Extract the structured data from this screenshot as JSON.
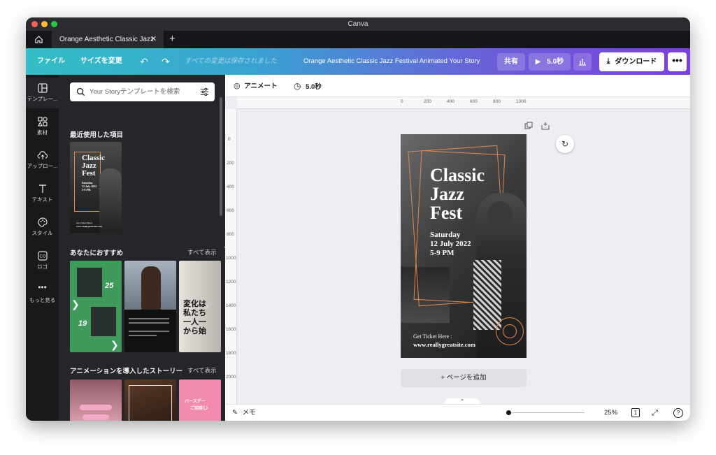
{
  "window": {
    "title": "Canva"
  },
  "tabs": {
    "active_label": "Orange Aesthetic Classic Jazz"
  },
  "toolbar": {
    "file_label": "ファイル",
    "resize_label": "サイズを変更",
    "saved_status": "すべての変更は保存されました",
    "document_title": "Orange Aesthetic Classic Jazz Festival Animated Your Story",
    "share_label": "共有",
    "play_label": "5.0秒",
    "download_label": "ダウンロード",
    "more_label": "•••"
  },
  "rail": {
    "items": [
      {
        "label": "テンプレー..."
      },
      {
        "label": "素材"
      },
      {
        "label": "アップロー..."
      },
      {
        "label": "テキスト"
      },
      {
        "label": "スタイル"
      },
      {
        "label": "ロゴ"
      },
      {
        "label": "もっと見る"
      }
    ]
  },
  "panel": {
    "search_placeholder": "Your Storyテンプレートを検索",
    "recent_title": "最近使用した項目",
    "recommended_title": "あなたにおすすめ",
    "recommended_see_all": "すべて表示",
    "animated_title": "アニメーションを導入したストーリー",
    "animated_see_all": "すべて表示",
    "recent_thumb": {
      "title_line1": "Classic",
      "title_line2": "Jazz",
      "title_line3": "Fest",
      "date_line1": "Saturday",
      "date_line2": "12 July 2022",
      "date_line3": "5-9 PM",
      "ticket": "Get Ticket Here :",
      "site": "www.reallygreatsite.com"
    },
    "rec_thumb1": {
      "num1": "25",
      "num2": "19"
    },
    "rec_thumb3": {
      "line1": "変化は",
      "line2": "私たち",
      "line3": "一人一",
      "line4": "から始"
    },
    "anim_thumb3": {
      "line1": "バースデー",
      "line2": "ご招待し"
    }
  },
  "context_bar": {
    "animate_label": "アニメート",
    "duration_label": "5.0秒"
  },
  "ruler": {
    "top_ticks": [
      "0",
      "200",
      "400",
      "600",
      "800",
      "1000"
    ],
    "left_ticks": [
      "0",
      "200",
      "400",
      "600",
      "800",
      "1000",
      "1200",
      "1400",
      "1600",
      "1800",
      "2000"
    ]
  },
  "poster": {
    "title_line1": "Classic",
    "title_line2": "Jazz",
    "title_line3": "Fest",
    "date_line1": "Saturday",
    "date_line2": "12 July 2022",
    "date_line3": "5-9 PM",
    "ticket_label": "Get Ticket Here :",
    "website": "www.reallygreatsite.com"
  },
  "canvas": {
    "add_page_label": "+ ページを追加"
  },
  "footer": {
    "notes_label": "メモ",
    "zoom_level": "25%",
    "page_count": "1",
    "help_label": "?"
  },
  "colors": {
    "accent_orange": "#e08a4f",
    "toolbar_start": "#33bfc5",
    "toolbar_end": "#7b3fe0"
  }
}
